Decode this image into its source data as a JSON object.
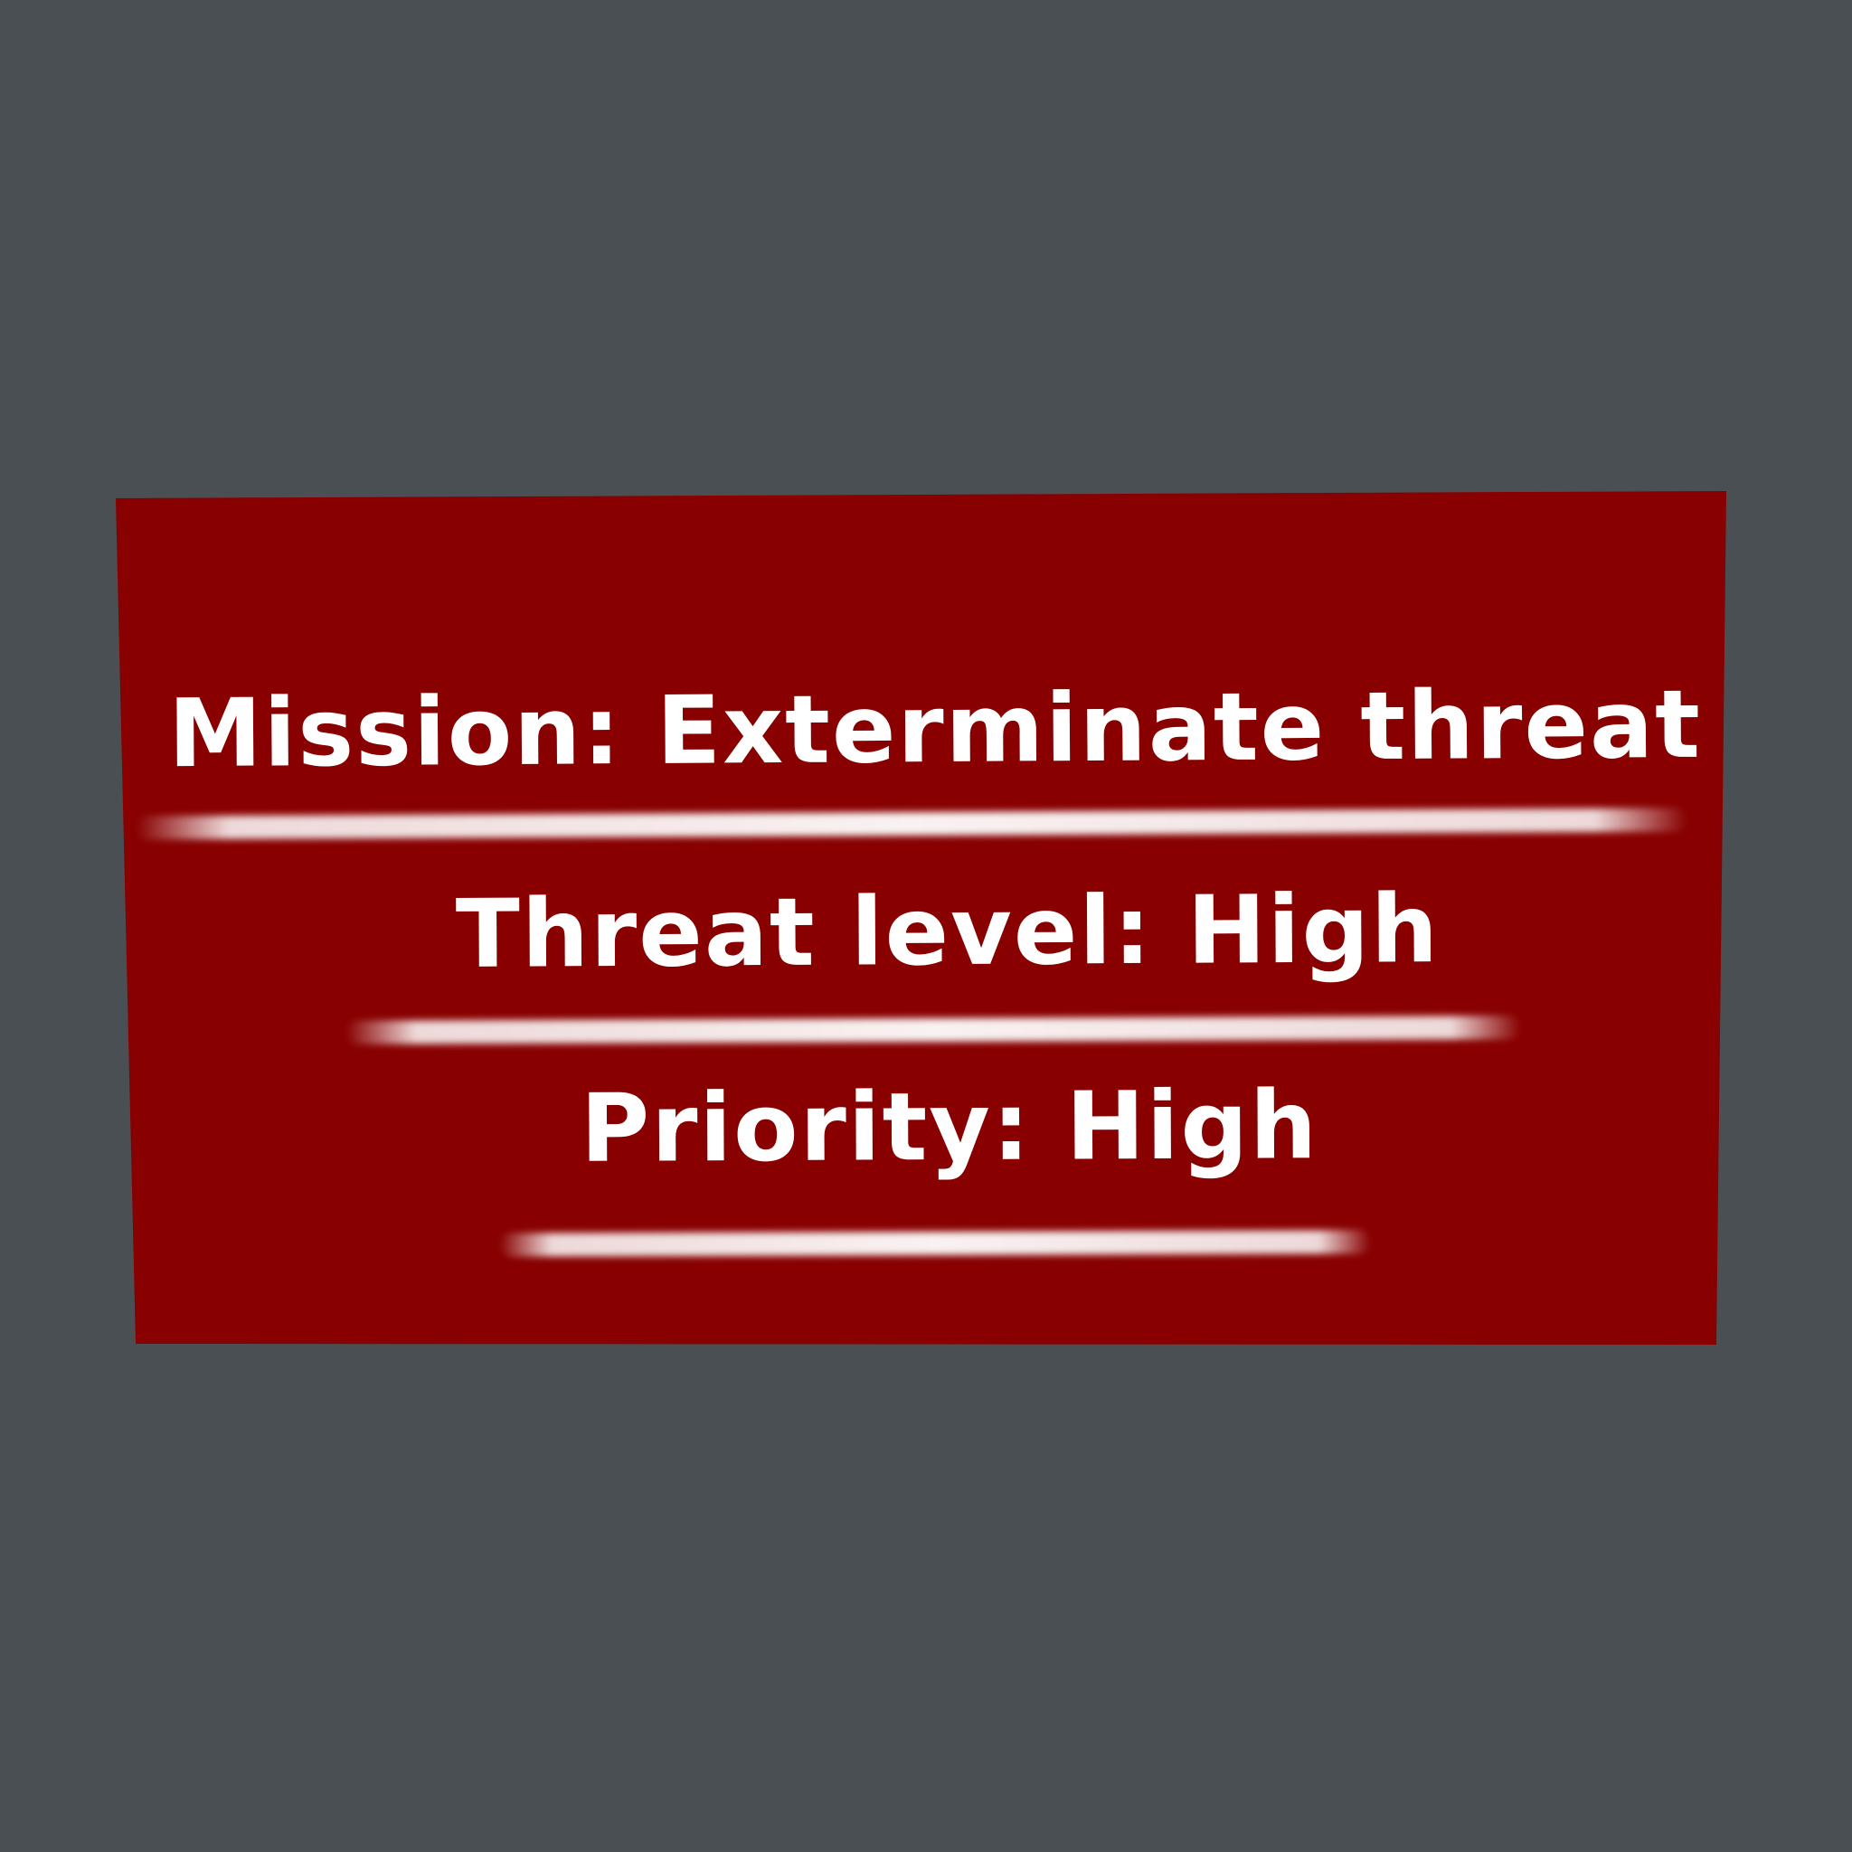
{
  "colors": {
    "background": "#4a4f53",
    "panel": "#880000",
    "text": "#ffffff"
  },
  "briefing": {
    "mission": "Mission: Exterminate threat",
    "threat_level": "Threat level: High",
    "priority": "Priority: High"
  }
}
